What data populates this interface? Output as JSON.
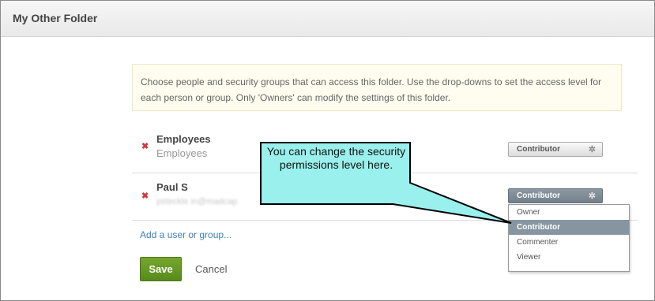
{
  "dialog": {
    "title": "My Other Folder"
  },
  "notice": {
    "text": "Choose people and security groups that can access this folder. Use the drop-downs to set the access level for each person or group. Only 'Owners' can modify the settings of this folder."
  },
  "members": [
    {
      "name": "Employees",
      "subtitle": "Employees",
      "remove_icon": "remove-x-icon",
      "permission": "Contributor"
    },
    {
      "name": "Paul S",
      "subtitle": "psteckle in@madcap",
      "remove_icon": "remove-x-icon",
      "permission": "Contributor"
    }
  ],
  "permission_menu": {
    "options": [
      "Owner",
      "Contributor",
      "Commenter",
      "Viewer"
    ],
    "selected": "Contributor"
  },
  "actions": {
    "add_link": "Add a user or group...",
    "save_label": "Save",
    "cancel_label": "Cancel"
  },
  "callout": {
    "text": "You can change the security permissions level here.",
    "fill_color": "#99f0ec"
  },
  "colors": {
    "save_button": "#5f9322",
    "link": "#3f7fbf",
    "remove_icon": "#d23a3a"
  }
}
